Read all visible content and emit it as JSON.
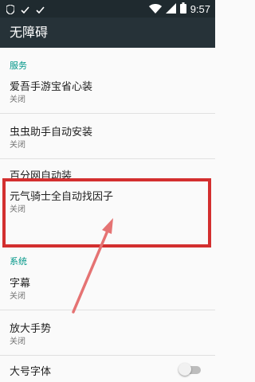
{
  "status_bar": {
    "time": "9:57",
    "left_icons": [
      "shield-icon",
      "check-icon",
      "check-icon"
    ],
    "right_icons": [
      "wifi-icon",
      "signal-icon",
      "battery-icon"
    ]
  },
  "app_bar": {
    "title": "无障碍"
  },
  "sections": [
    {
      "header": "服务",
      "items": [
        {
          "title": "爱吾手游宝省心装",
          "summary": "关闭"
        },
        {
          "title": "虫虫助手自动安装",
          "summary": "关闭"
        },
        {
          "title": "百分网自动装",
          "summary": ""
        },
        {
          "title": "元气骑士全自动找因子",
          "summary": "关闭"
        }
      ]
    },
    {
      "header": "系统",
      "items": [
        {
          "title": "字幕",
          "summary": "关闭"
        },
        {
          "title": "放大手势",
          "summary": "关闭"
        },
        {
          "title": "大号字体",
          "summary": "",
          "toggle": false
        }
      ]
    }
  ],
  "colors": {
    "status_bar": "#1f2a2f",
    "app_bar": "#263238",
    "section_header": "#009688",
    "highlight": "#d32f2f"
  }
}
